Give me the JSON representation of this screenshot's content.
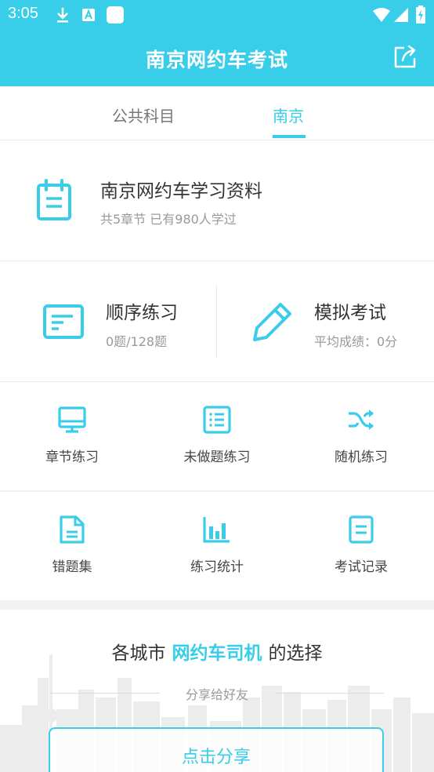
{
  "status_bar": {
    "time": "3:05"
  },
  "app_bar": {
    "title": "南京网约车考试"
  },
  "tabs": [
    {
      "label": "公共科目",
      "active": false
    },
    {
      "label": "南京",
      "active": true
    }
  ],
  "material": {
    "title": "南京网约车学习资料",
    "subtitle": "共5章节  已有980人学过"
  },
  "practice": {
    "sequential": {
      "title": "顺序练习",
      "sub": "0题/128题"
    },
    "mock": {
      "title": "模拟考试",
      "sub": "平均成绩：0分"
    }
  },
  "grid": [
    {
      "label": "章节练习",
      "icon": "monitor-icon"
    },
    {
      "label": "未做题练习",
      "icon": "list-icon"
    },
    {
      "label": "随机练习",
      "icon": "shuffle-icon"
    },
    {
      "label": "错题集",
      "icon": "document-icon"
    },
    {
      "label": "练习统计",
      "icon": "bar-chart-icon"
    },
    {
      "label": "考试记录",
      "icon": "record-icon"
    }
  ],
  "promo": {
    "prefix": "各城市",
    "highlight": "网约车司机",
    "suffix": "的选择",
    "share_text": "分享给好友",
    "button": "点击分享"
  },
  "colors": {
    "accent": "#38cde8"
  }
}
